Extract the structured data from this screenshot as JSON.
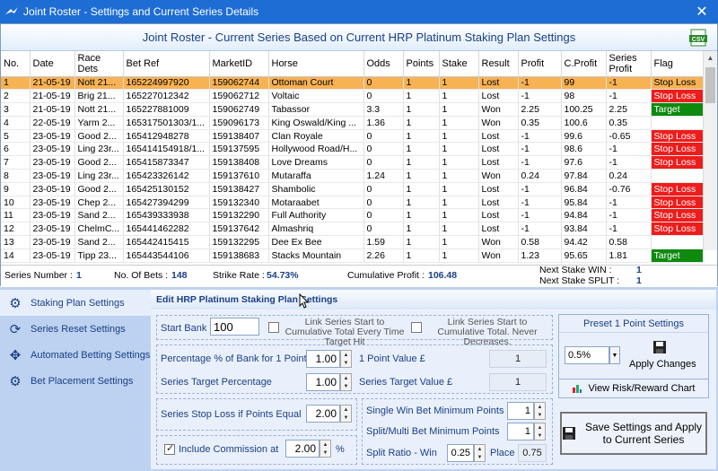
{
  "window": {
    "title": "Joint Roster - Settings and Current Series Details",
    "close": "✕"
  },
  "roster": {
    "heading": "Joint Roster - Current Series Based on Current HRP Platinum Staking Plan Settings",
    "columns": [
      "No.",
      "Date",
      "Race Dets",
      "Bet Ref",
      "MarketID",
      "Horse",
      "Odds",
      "Points",
      "Stake",
      "Result",
      "Profit",
      "C.Profit",
      "Series Profit",
      "Flag"
    ],
    "rows": [
      [
        "1",
        "21-05-19",
        "Nott 21...",
        "165224997920",
        "159062744",
        "Ottoman Court",
        "0",
        "1",
        "1",
        "Lost",
        "-1",
        "99",
        "-1",
        "Stop Loss"
      ],
      [
        "2",
        "21-05-19",
        "Brig 21...",
        "165227012342",
        "159062712",
        "Voltaic",
        "0",
        "1",
        "1",
        "Lost",
        "-1",
        "98",
        "-1",
        "Stop Loss"
      ],
      [
        "3",
        "21-05-19",
        "Nott 21...",
        "165227881009",
        "159062749",
        "Tabassor",
        "3.3",
        "1",
        "1",
        "Won",
        "2.25",
        "100.25",
        "2.25",
        "Target"
      ],
      [
        "4",
        "22-05-19",
        "Yarm 2...",
        "165317501303/1...",
        "159096173",
        "King Oswald/King ...",
        "1.36",
        "1",
        "1",
        "Won",
        "0.35",
        "100.6",
        "0.35",
        ""
      ],
      [
        "5",
        "23-05-19",
        "Good 2...",
        "165412948278",
        "159138407",
        "Clan Royale",
        "0",
        "1",
        "1",
        "Lost",
        "-1",
        "99.6",
        "-0.65",
        "Stop Loss"
      ],
      [
        "6",
        "23-05-19",
        "Ling 23r...",
        "165414154918/1...",
        "159137595",
        "Hollywood Road/H...",
        "0",
        "1",
        "1",
        "Lost",
        "-1",
        "98.6",
        "-1",
        "Stop Loss"
      ],
      [
        "7",
        "23-05-19",
        "Good 2...",
        "165415873347",
        "159138408",
        "Love Dreams",
        "0",
        "1",
        "1",
        "Lost",
        "-1",
        "97.6",
        "-1",
        "Stop Loss"
      ],
      [
        "8",
        "23-05-19",
        "Ling 23r...",
        "165423326142",
        "159137610",
        "Mutaraffa",
        "1.24",
        "1",
        "1",
        "Won",
        "0.24",
        "97.84",
        "0.24",
        ""
      ],
      [
        "9",
        "23-05-19",
        "Good 2...",
        "165425130152",
        "159138427",
        "Shambolic",
        "0",
        "1",
        "1",
        "Lost",
        "-1",
        "96.84",
        "-0.76",
        "Stop Loss"
      ],
      [
        "10",
        "23-05-19",
        "Chep 2...",
        "165427394299",
        "159132340",
        "Motaraabet",
        "0",
        "1",
        "1",
        "Lost",
        "-1",
        "95.84",
        "-1",
        "Stop Loss"
      ],
      [
        "11",
        "23-05-19",
        "Sand 2...",
        "165439333938",
        "159132290",
        "Full Authority",
        "0",
        "1",
        "1",
        "Lost",
        "-1",
        "94.84",
        "-1",
        "Stop Loss"
      ],
      [
        "12",
        "23-05-19",
        "ChelmC...",
        "165441462282",
        "159137642",
        "Almashriq",
        "0",
        "1",
        "1",
        "Lost",
        "-1",
        "93.84",
        "-1",
        "Stop Loss"
      ],
      [
        "13",
        "23-05-19",
        "Sand 2...",
        "165442415415",
        "159132295",
        "Dee Ex Bee",
        "1.59",
        "1",
        "1",
        "Won",
        "0.58",
        "94.42",
        "0.58",
        ""
      ],
      [
        "14",
        "23-05-19",
        "Tipp 23...",
        "165443544106",
        "159138683",
        "Stacks Mountain",
        "2.26",
        "1",
        "1",
        "Won",
        "1.23",
        "95.65",
        "1.81",
        "Target"
      ]
    ]
  },
  "summary": {
    "series_number_label": "Series Number :",
    "series_number": "1",
    "no_bets_label": "No. Of Bets :",
    "no_bets": "148",
    "strike_rate_label": "Strike Rate :",
    "strike_rate": "54.73%",
    "cum_profit_label": "Cumulative Profit :",
    "cum_profit": "106.48",
    "next_win_label": "Next Stake WIN :",
    "next_win": "1",
    "next_split_label": "Next Stake SPLIT :",
    "next_split": "1"
  },
  "sidebar": {
    "items": [
      "Staking Plan Settings",
      "Series Reset Settings",
      "Automated Betting Settings",
      "Bet Placement Settings"
    ]
  },
  "settings": {
    "title": "Edit HRP Platinum Staking Plan Settings",
    "start_bank_label": "Start Bank",
    "start_bank": "100",
    "link_every_label": "Link Series Start to Cumulative Total Every Time Target Hit",
    "link_never_label": "Link Series Start to Cumulative Total. Never Decreases.",
    "pct_bank_label": "Percentage % of Bank for 1 Point",
    "pct_bank": "1.00",
    "point_value_label": "1 Point Value £",
    "point_value": "1",
    "series_target_pct_label": "Series Target Percentage",
    "series_target_pct": "1.00",
    "series_target_value_label": "Series Target Value £",
    "series_target_value": "1",
    "stop_loss_label": "Series Stop Loss if Points Equal",
    "stop_loss": "2.00",
    "single_min_label": "Single Win Bet Minimum Points",
    "single_min": "1",
    "split_min_label": "Split/Multi Bet Minimum Points",
    "split_min": "1",
    "split_ratio_label": "Split Ratio - Win",
    "split_win": "0.25",
    "place_label": "Place",
    "split_place": "0.75",
    "commission_label": "Include Commission at",
    "commission": "2.00",
    "pct_sign": "%"
  },
  "preset": {
    "title": "Preset 1 Point Settings",
    "selected": "0.5%",
    "apply_label": "Apply Changes",
    "risk_label": "View Risk/Reward Chart",
    "save_label": "Save Settings and Apply to Current Series"
  }
}
